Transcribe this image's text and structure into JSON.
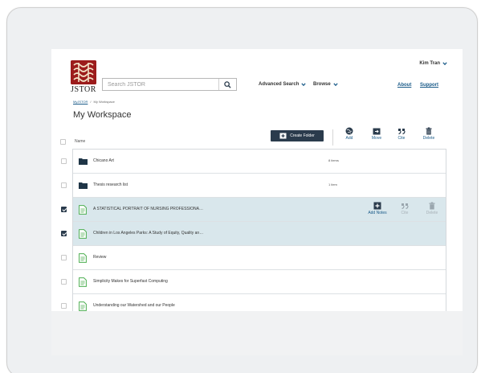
{
  "header": {
    "logo_text": "JSTOR",
    "search_placeholder": "Search JSTOR",
    "nav": {
      "advanced_search": "Advanced Search",
      "browse": "Browse"
    },
    "user_name": "Kim Tran",
    "about": "About",
    "support": "Support"
  },
  "breadcrumb": {
    "root": "MyJSTOR",
    "separator": "/",
    "current": "My Workspace"
  },
  "page_title": "My Workspace",
  "toolbar": {
    "create_folder": "Create Folder",
    "add": "Add",
    "move": "Move",
    "cite": "Cite",
    "delete": "Delete"
  },
  "list_header": {
    "name": "Name"
  },
  "rows": [
    {
      "type": "folder",
      "title": "Chicano Art",
      "meta": "8 items",
      "checked": false
    },
    {
      "type": "folder",
      "title": "Thesis research list",
      "meta": "1 item",
      "checked": false
    },
    {
      "type": "document",
      "title": "A STATISTICAL PORTRAIT OF NURSING PROFESSIONA…",
      "meta": "",
      "checked": true
    },
    {
      "type": "document",
      "title": "Children in Los Angeles Parks: A Study of Equity, Quality an…",
      "meta": "",
      "checked": true
    },
    {
      "type": "document",
      "title": "Review",
      "meta": "",
      "checked": false
    },
    {
      "type": "document",
      "title": "Simplicity Makes for Superfast Computing",
      "meta": "",
      "checked": false
    },
    {
      "type": "document",
      "title": "Understanding our Watershed and our People",
      "meta": "",
      "checked": false
    }
  ],
  "row_actions": {
    "add_notes": "Add Notes",
    "cite": "Cite",
    "delete": "Delete"
  },
  "colors": {
    "brand_red": "#9c1c1c",
    "navy": "#2a3b4c",
    "link_blue": "#1a5b89",
    "selected_row": "#d9e7ec",
    "doc_green": "#4caf50"
  }
}
